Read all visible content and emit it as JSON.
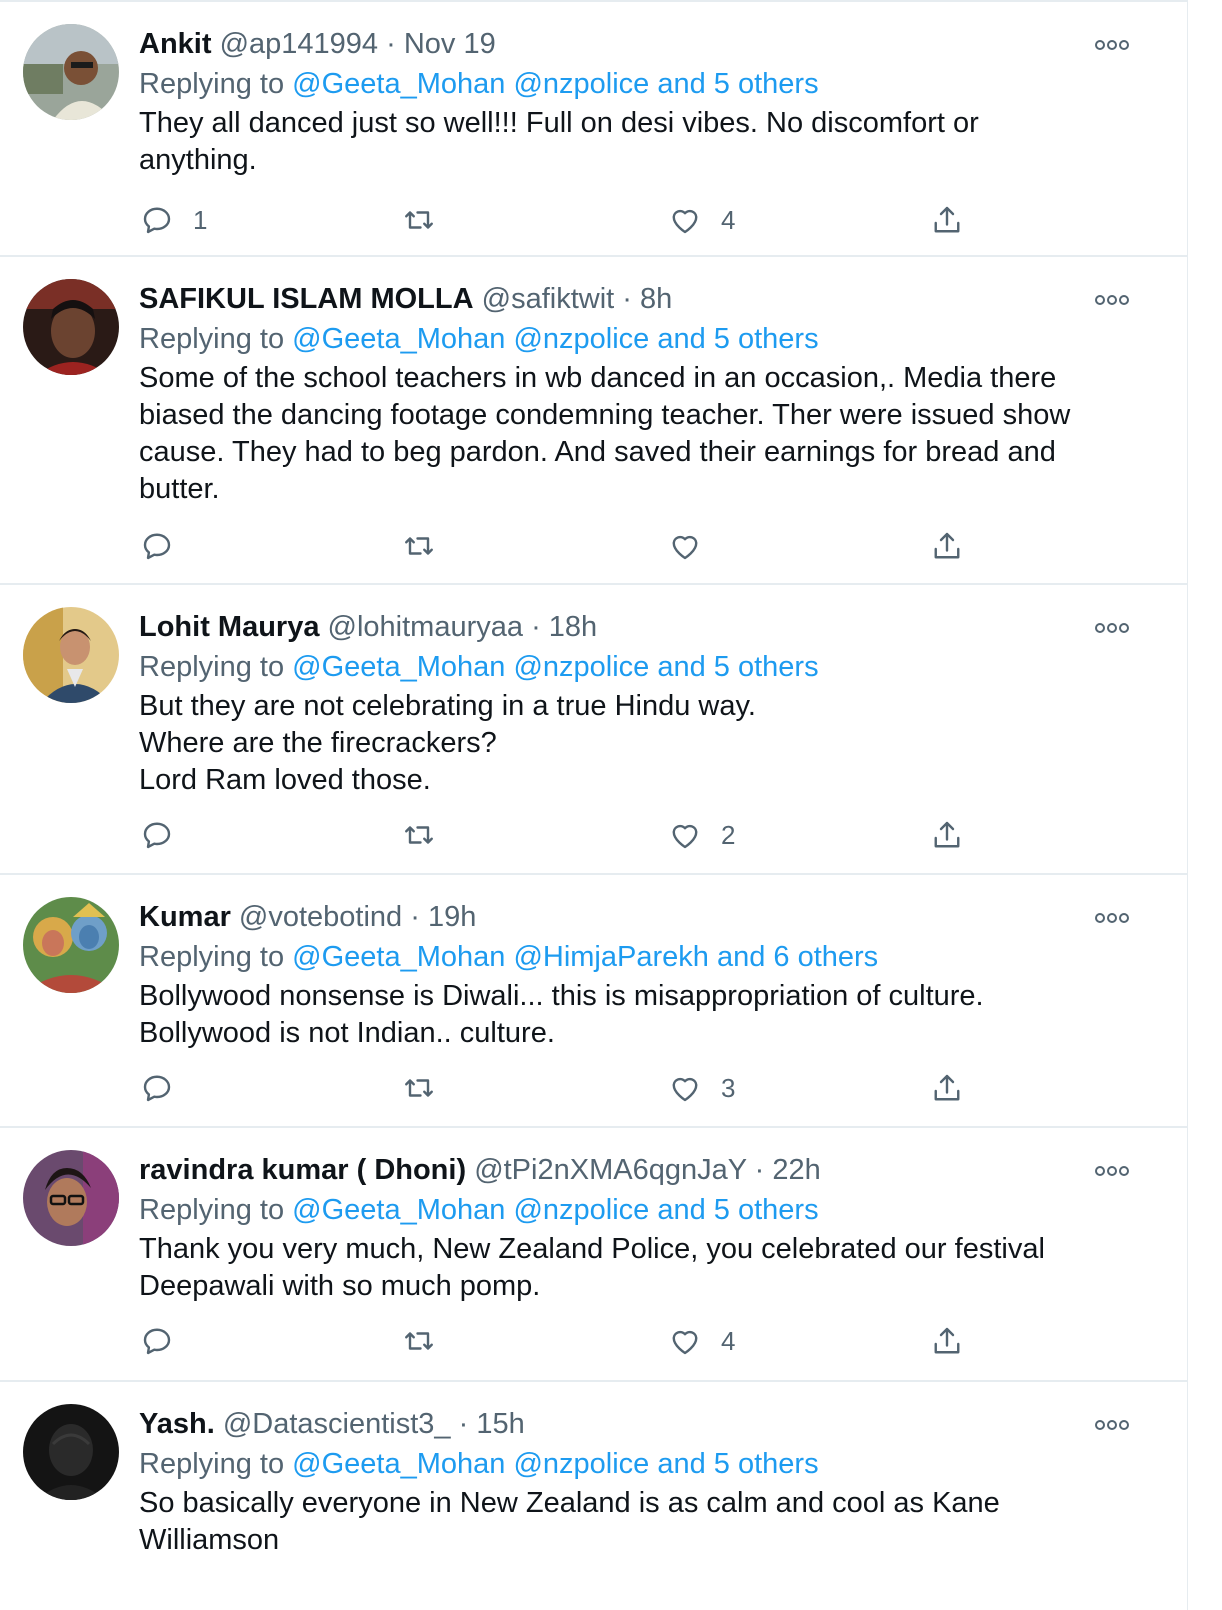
{
  "tweets": [
    {
      "name": "Ankit",
      "handle": "@ap141994",
      "time": "Nov 19",
      "replying_label": "Replying to",
      "mentions": "@Geeta_Mohan @nzpolice and 5 others",
      "text": "They all danced just so well!!! Full on desi vibes. No discomfort or\nanything.",
      "reply_count": "1",
      "like_count": "4"
    },
    {
      "name": "SAFIKUL ISLAM MOLLA",
      "handle": "@safiktwit",
      "time": "8h",
      "replying_label": "Replying to",
      "mentions": "@Geeta_Mohan @nzpolice and 5 others",
      "text": "Some of the school teachers in wb danced in an occasion,. Media there\nbiased the dancing footage condemning teacher. Ther were issued show\ncause. They had to beg pardon. And saved their earnings for bread and\nbutter.",
      "reply_count": "",
      "like_count": ""
    },
    {
      "name": "Lohit Maurya",
      "handle": "@lohitmauryaa",
      "time": "18h",
      "replying_label": "Replying to",
      "mentions": "@Geeta_Mohan @nzpolice and 5 others",
      "text": "But they are not celebrating in a true Hindu way.\nWhere are the firecrackers?\nLord Ram loved those.",
      "reply_count": "",
      "like_count": "2"
    },
    {
      "name": "Kumar",
      "handle": "@votebotind",
      "time": "19h",
      "replying_label": "Replying to",
      "mentions": "@Geeta_Mohan @HimjaParekh and 6 others",
      "text": "Bollywood nonsense is Diwali... this is misappropriation of culture.\nBollywood is not Indian.. culture.",
      "reply_count": "",
      "like_count": "3"
    },
    {
      "name": "ravindra kumar ( Dhoni)",
      "handle": "@tPi2nXMA6qgnJaY",
      "time": "22h",
      "replying_label": "Replying to",
      "mentions": "@Geeta_Mohan @nzpolice and 5 others",
      "text": "Thank you very much, New Zealand Police, you celebrated our festival\nDeepawali with so much pomp.",
      "reply_count": "",
      "like_count": "4"
    },
    {
      "name": "Yash.",
      "handle": "@Datascientist3_",
      "time": "15h",
      "replying_label": "Replying to",
      "mentions": "@Geeta_Mohan @nzpolice and 5 others",
      "text": "So basically everyone in New Zealand is as calm and cool as Kane\nWilliamson",
      "reply_count": "",
      "like_count": ""
    }
  ],
  "separator": "·",
  "icons": {
    "more": "more-dots-icon",
    "reply": "reply-bubble-icon",
    "retweet": "retweet-icon",
    "like": "heart-icon",
    "share": "share-upload-icon"
  },
  "colors": {
    "mention": "#1d9bf0",
    "secondary_text": "#536471",
    "primary_text": "#0f1419",
    "divider": "#e6ecf0"
  }
}
